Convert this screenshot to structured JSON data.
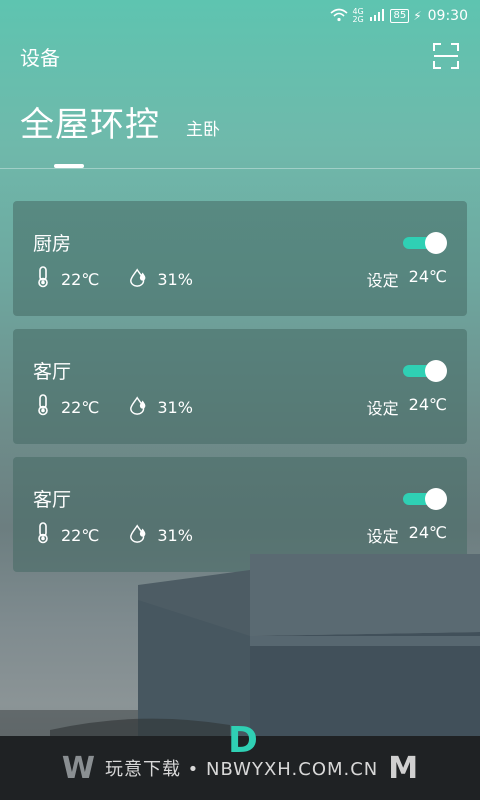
{
  "status": {
    "network": "4G 2G",
    "battery": "85",
    "time": "09:30"
  },
  "header": {
    "title": "设备",
    "scan_icon": "scan-icon"
  },
  "tabs": [
    {
      "label": "全屋环控",
      "active": true
    },
    {
      "label": "主卧",
      "active": false
    }
  ],
  "cards": [
    {
      "name": "厨房",
      "on": true,
      "temp": "22℃",
      "humidity": "31%",
      "set_label": "设定",
      "set_value": "24℃"
    },
    {
      "name": "客厅",
      "on": true,
      "temp": "22℃",
      "humidity": "31%",
      "set_label": "设定",
      "set_value": "24℃"
    },
    {
      "name": "客厅",
      "on": true,
      "temp": "22℃",
      "humidity": "31%",
      "set_label": "设定",
      "set_value": "24℃"
    }
  ],
  "watermark": {
    "left_logo": "W",
    "text": "玩意下载 • NBWYXH.COM.CN",
    "mid_logo": "D",
    "right_logo": "M"
  },
  "colors": {
    "accent": "#2fd0b4",
    "top_gradient": "#5ec4b0"
  }
}
